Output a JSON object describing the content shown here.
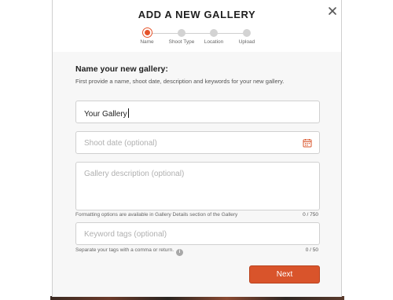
{
  "dialog": {
    "title": "ADD A NEW GALLERY",
    "close_icon": "close-icon"
  },
  "steps": [
    {
      "label": "Name",
      "active": true
    },
    {
      "label": "Shoot Type",
      "active": false
    },
    {
      "label": "Location",
      "active": false
    },
    {
      "label": "Upload",
      "active": false
    }
  ],
  "form": {
    "heading": "Name your new gallery:",
    "description": "First provide a name, shoot date, description and keywords for your new gallery.",
    "gallery_name": {
      "value": "Your Gallery"
    },
    "shoot_date": {
      "placeholder": "Shoot date (optional)",
      "icon": "calendar-icon"
    },
    "gallery_description": {
      "placeholder": "Gallery description (optional)",
      "hint": "Formatting options are available in Gallery Details section of the Gallery",
      "counter": "0 / 750"
    },
    "keyword_tags": {
      "placeholder": "Keyword tags (optional)",
      "hint": "Separate your tags with a comma or return.",
      "hint_icon": "info-icon",
      "counter": "0 / 50"
    }
  },
  "actions": {
    "next_label": "Next"
  },
  "colors": {
    "accent": "#d9542b",
    "inactive_step": "#d3d3d3",
    "modal_background": "#f7f7f7"
  }
}
